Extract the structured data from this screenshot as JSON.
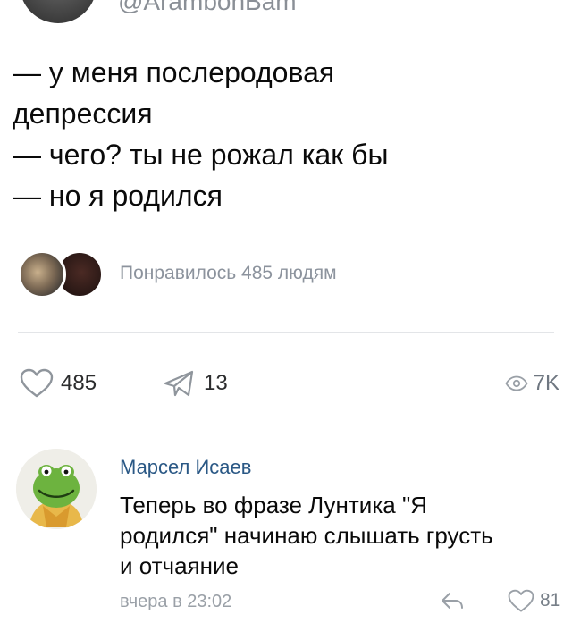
{
  "header": {
    "handle": "@ArambonBam"
  },
  "post": {
    "lines": [
      "— у меня послеродовая",
      "депрессия",
      "— чего? ты не рожал как бы",
      "— но я родился"
    ],
    "likers_text": "Понравилось 485 людям"
  },
  "actions": {
    "likes": "485",
    "shares": "13",
    "views": "7K"
  },
  "comment": {
    "author": "Марсел Исаев",
    "lines": [
      "Теперь во фразе Лунтика \"Я",
      "родился\" начинаю слышать грусть",
      "и отчаяние"
    ],
    "time": "вчера в 23:02",
    "likes": "81"
  },
  "colors": {
    "link": "#2a5885",
    "muted": "#8c939d",
    "icon": "#8f959c"
  },
  "icons": [
    "heart-icon",
    "share-icon",
    "eye-icon",
    "reply-icon"
  ]
}
